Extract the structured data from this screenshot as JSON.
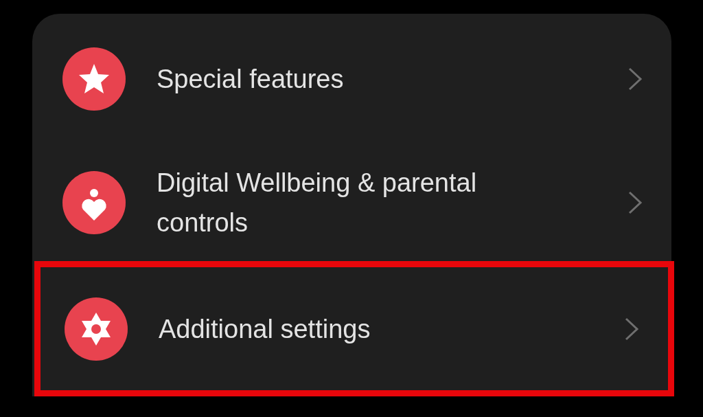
{
  "settings_items": [
    {
      "label": "Special features",
      "highlighted": false
    },
    {
      "label": "Digital Wellbeing & parental controls",
      "highlighted": false
    },
    {
      "label": "Additional settings",
      "highlighted": true
    }
  ]
}
